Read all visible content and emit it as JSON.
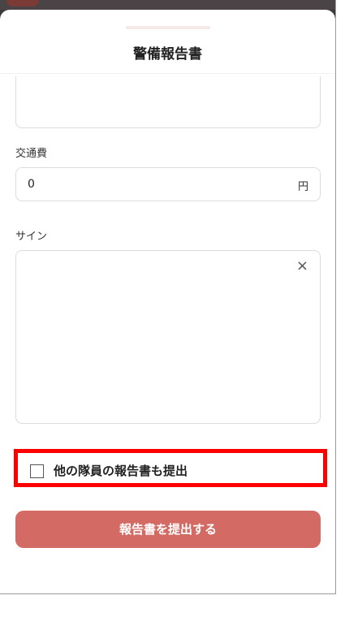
{
  "sheet": {
    "title": "警備報告書"
  },
  "fare": {
    "label": "交通費",
    "value": "0",
    "unit": "円"
  },
  "signature": {
    "label": "サイン",
    "clear_icon": "×"
  },
  "other_members": {
    "label": "他の隊員の報告書も提出",
    "checked": false
  },
  "submit": {
    "label": "報告書を提出する"
  },
  "colors": {
    "accent": "#d36a64",
    "highlight": "#ff0000"
  }
}
